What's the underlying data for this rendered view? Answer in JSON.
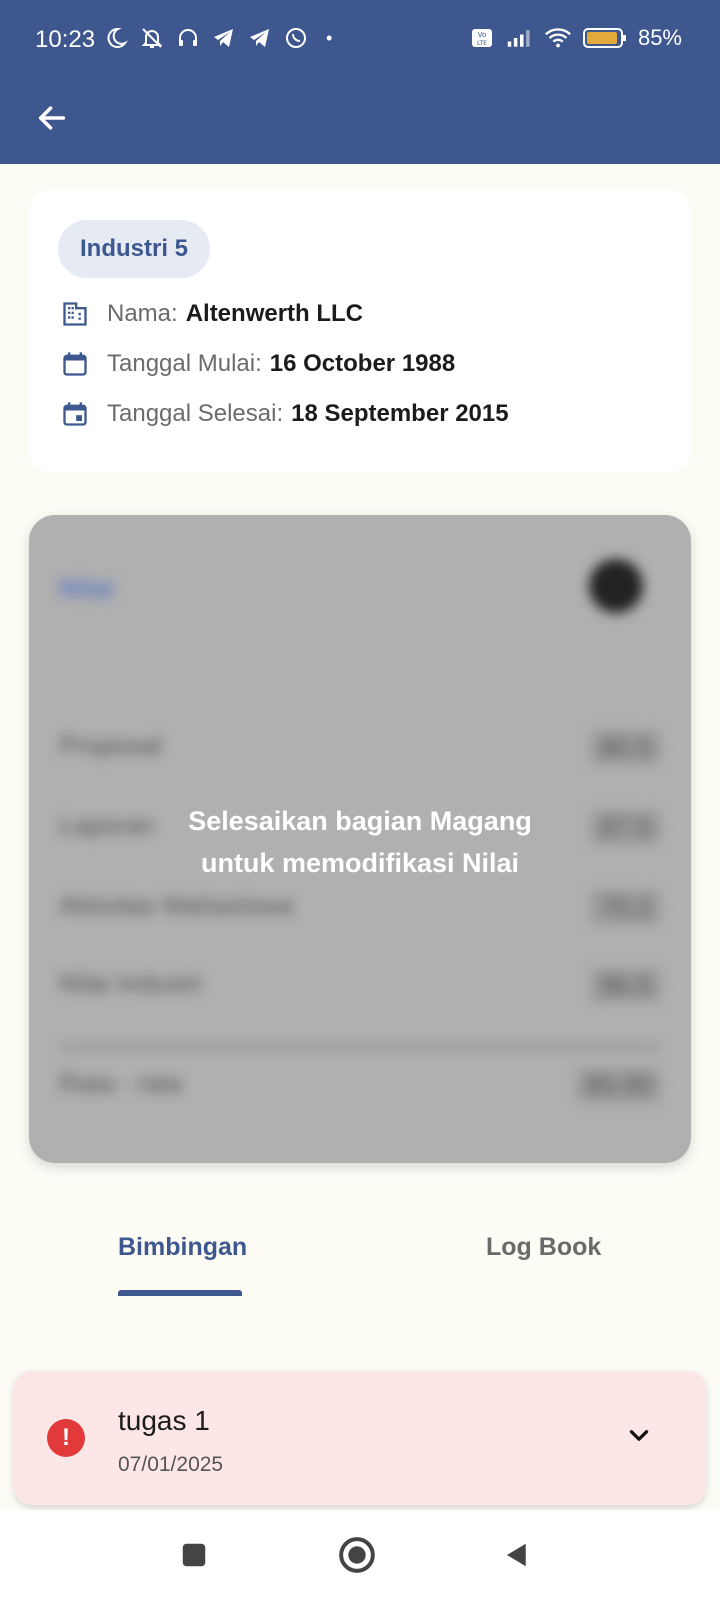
{
  "status_bar": {
    "time": "10:23",
    "battery": "85%"
  },
  "info": {
    "chip_label": "Industri 5",
    "nama_label": "Nama:",
    "nama_value": "Altenwerth LLC",
    "mulai_label": "Tanggal Mulai:",
    "mulai_value": "16 October 1988",
    "selesai_label": "Tanggal Selesai:",
    "selesai_value": "18 September 2015"
  },
  "nilai": {
    "title": "Nilai",
    "rows": [
      {
        "label": "Proposal",
        "score": "80.5"
      },
      {
        "label": "Laporan",
        "score": "87.5"
      },
      {
        "label": "Aktivitas Mahasiswa",
        "score": "75.2"
      },
      {
        "label": "Nilai Industri",
        "score": "96.5"
      }
    ],
    "average_label": "Rata - rata",
    "average_score": "85.00",
    "overlay_line1": "Selesaikan bagian Magang",
    "overlay_line2": "untuk memodifikasi Nilai"
  },
  "tabs": [
    {
      "label": "Bimbingan",
      "active": true
    },
    {
      "label": "Log Book",
      "active": false
    }
  ],
  "task": {
    "title": "tugas 1",
    "date": "07/01/2025"
  },
  "colors": {
    "primary": "#3E578F",
    "background": "#FCFCF5",
    "task_bg": "#FDE6E6",
    "alert": "#E23A3A"
  }
}
